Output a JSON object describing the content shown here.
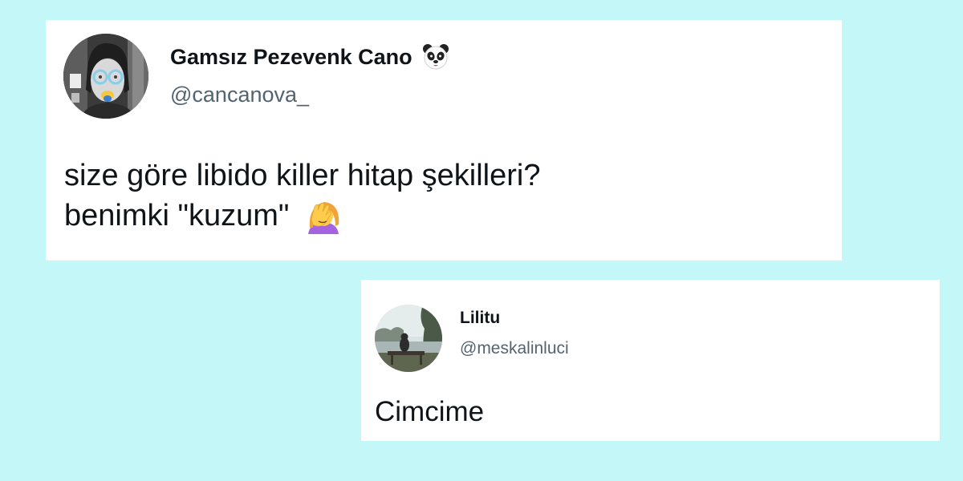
{
  "main_tweet": {
    "author": {
      "display_name": "Gamsız Pezevenk Cano",
      "handle": "@cancanova_",
      "name_emoji": "panda-icon",
      "avatar": "profile-photo-woman-with-glasses"
    },
    "lines": [
      "size göre libido killer hitap şekilleri?",
      "benimki \"kuzum\""
    ],
    "line_emoji": "woman-facepalming-icon"
  },
  "reply_tweet": {
    "author": {
      "display_name": "Lilitu",
      "handle": "@meskalinluci",
      "avatar": "profile-photo-person-on-bench-by-water"
    },
    "text": "Cimcime"
  },
  "colors": {
    "page_background": "#c4f8f8",
    "card_background": "#ffffff",
    "text_primary": "#0f1419",
    "text_secondary": "#536471"
  }
}
